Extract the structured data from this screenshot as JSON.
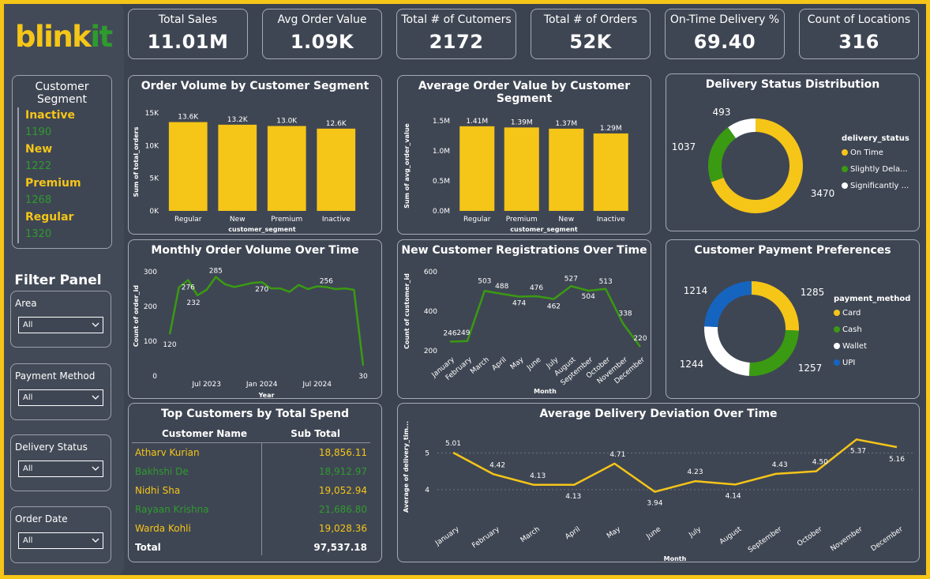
{
  "brand": {
    "part1": "blink",
    "part2": "it"
  },
  "segment_slicer": {
    "title": "Customer Segment",
    "items": [
      {
        "name": "Inactive",
        "count": "1190"
      },
      {
        "name": "New",
        "count": "1222"
      },
      {
        "name": "Premium",
        "count": "1268"
      },
      {
        "name": "Regular",
        "count": "1320"
      }
    ]
  },
  "filters": {
    "title": "Filter Panel",
    "items": [
      {
        "label": "Area",
        "value": "All"
      },
      {
        "label": "Payment Method",
        "value": "All"
      },
      {
        "label": "Delivery Status",
        "value": "All"
      },
      {
        "label": "Order Date",
        "value": "All"
      }
    ]
  },
  "kpis": [
    {
      "label": "Total Sales",
      "value": "11.01M"
    },
    {
      "label": "Avg Order Value",
      "value": "1.09K"
    },
    {
      "label": "Total # of Cutomers",
      "value": "2172"
    },
    {
      "label": "Total # of Orders",
      "value": "52K"
    },
    {
      "label": "On-Time Delivery %",
      "value": "69.40"
    },
    {
      "label": "Count of Locations",
      "value": "316"
    }
  ],
  "colors": {
    "yellow": "#f5c518",
    "green": "#3a9a12",
    "white": "#ffffff",
    "blue": "#1565c0"
  },
  "chart_data": [
    {
      "id": "order_volume",
      "type": "bar",
      "title": "Order Volume by Customer Segment",
      "xlabel": "customer_segment",
      "ylabel": "Sum of total_orders",
      "categories": [
        "Regular",
        "New",
        "Premium",
        "Inactive"
      ],
      "values": [
        13600,
        13200,
        13000,
        12600
      ],
      "data_labels": [
        "13.6K",
        "13.2K",
        "13.0K",
        "12.6K"
      ],
      "ylim": [
        0,
        15000
      ],
      "yticks": [
        0,
        5000,
        10000,
        15000
      ],
      "ytick_labels": [
        "0K",
        "5K",
        "10K",
        "15K"
      ]
    },
    {
      "id": "avg_order_value",
      "type": "bar",
      "title": "Average Order Value by Customer Segment",
      "xlabel": "customer_segment",
      "ylabel": "Sum of avg_order_value",
      "categories": [
        "Regular",
        "Premium",
        "New",
        "Inactive"
      ],
      "values": [
        1410000,
        1390000,
        1370000,
        1290000
      ],
      "data_labels": [
        "1.41M",
        "1.39M",
        "1.37M",
        "1.29M"
      ],
      "ylim": [
        0,
        1500000
      ],
      "yticks": [
        0,
        500000,
        1000000,
        1500000
      ],
      "ytick_labels": [
        "0.0M",
        "0.5M",
        "1.0M",
        "1.5M"
      ]
    },
    {
      "id": "delivery_status",
      "type": "pie",
      "title": "Delivery Status Distribution",
      "legend_title": "delivery_status",
      "legend_labels": [
        "On Time",
        "Slightly Dela...",
        "Significantly ..."
      ],
      "values": [
        3470,
        1037,
        493
      ],
      "data_labels": [
        "3470",
        "1037",
        "493"
      ]
    },
    {
      "id": "monthly_orders",
      "type": "line",
      "title": "Monthly Order Volume Over Time",
      "xlabel": "Year",
      "ylabel": "Count of order_id",
      "x": [
        "2023-03",
        "2023-04",
        "2023-05",
        "2023-06",
        "2023-07",
        "2023-08",
        "2023-09",
        "2023-10",
        "2023-11",
        "2023-12",
        "2024-01",
        "2024-02",
        "2024-03",
        "2024-04",
        "2024-05",
        "2024-06",
        "2024-07",
        "2024-08",
        "2024-09",
        "2024-10",
        "2024-11",
        "2024-12"
      ],
      "values": [
        120,
        255,
        276,
        232,
        248,
        285,
        264,
        256,
        262,
        268,
        270,
        252,
        252,
        242,
        262,
        250,
        258,
        256,
        250,
        252,
        248,
        30
      ],
      "point_labels": [
        {
          "i": 0,
          "text": "120"
        },
        {
          "i": 2,
          "text": "276"
        },
        {
          "i": 3,
          "text": "232"
        },
        {
          "i": 5,
          "text": "285"
        },
        {
          "i": 10,
          "text": "270"
        },
        {
          "i": 17,
          "text": "256"
        },
        {
          "i": 21,
          "text": "30"
        }
      ],
      "ylim": [
        0,
        300
      ],
      "yticks": [
        0,
        100,
        200,
        300
      ],
      "xtick_labels": [
        {
          "i": 4,
          "text": "Jul 2023"
        },
        {
          "i": 10,
          "text": "Jan 2024"
        },
        {
          "i": 16,
          "text": "Jul 2024"
        }
      ]
    },
    {
      "id": "new_registrations",
      "type": "line",
      "title": "New Customer Registrations Over Time",
      "xlabel": "Month",
      "ylabel": "Count of customer_id",
      "categories": [
        "January",
        "February",
        "March",
        "April",
        "May",
        "June",
        "July",
        "August",
        "September",
        "October",
        "November",
        "December"
      ],
      "values": [
        246,
        249,
        503,
        488,
        474,
        476,
        462,
        527,
        504,
        513,
        338,
        220
      ],
      "ylim": [
        200,
        600
      ],
      "yticks": [
        200,
        400,
        600
      ]
    },
    {
      "id": "payment_prefs",
      "type": "pie",
      "title": "Customer Payment Preferences",
      "legend_title": "payment_method",
      "legend_labels": [
        "Card",
        "Cash",
        "Wallet",
        "UPI"
      ],
      "values": [
        1285,
        1257,
        1244,
        1214
      ],
      "data_labels": [
        "1285",
        "1257",
        "1244",
        "1214"
      ]
    },
    {
      "id": "delivery_deviation",
      "type": "line",
      "title": "Average Delivery Deviation Over Time",
      "xlabel": "Month",
      "ylabel": "Average of delivery_tim...",
      "categories": [
        "January",
        "February",
        "March",
        "April",
        "May",
        "June",
        "July",
        "August",
        "September",
        "October",
        "November",
        "December"
      ],
      "values": [
        5.01,
        4.42,
        4.13,
        4.13,
        4.71,
        3.94,
        4.23,
        4.14,
        4.43,
        4.5,
        5.37,
        5.16
      ],
      "data_labels": [
        "5.01",
        "4.42",
        "4.13",
        "4.13",
        "4.71",
        "3.94",
        "4.23",
        "4.14",
        "4.43",
        "4.50",
        "5.37",
        "5.16"
      ],
      "yticks": [
        4,
        5
      ]
    }
  ],
  "top_customers": {
    "title": "Top Customers by Total Spend",
    "col1": "Customer Name",
    "col2": "Sub Total",
    "rows": [
      {
        "name": "Atharv Kurian",
        "value": "18,856.11"
      },
      {
        "name": "Bakhshi De",
        "value": "18,912.97"
      },
      {
        "name": "Nidhi Sha",
        "value": "19,052.94"
      },
      {
        "name": "Rayaan Krishna",
        "value": "21,686.80"
      },
      {
        "name": "Warda Kohli",
        "value": "19,028.36"
      }
    ],
    "total_label": "Total",
    "total_value": "97,537.18"
  }
}
